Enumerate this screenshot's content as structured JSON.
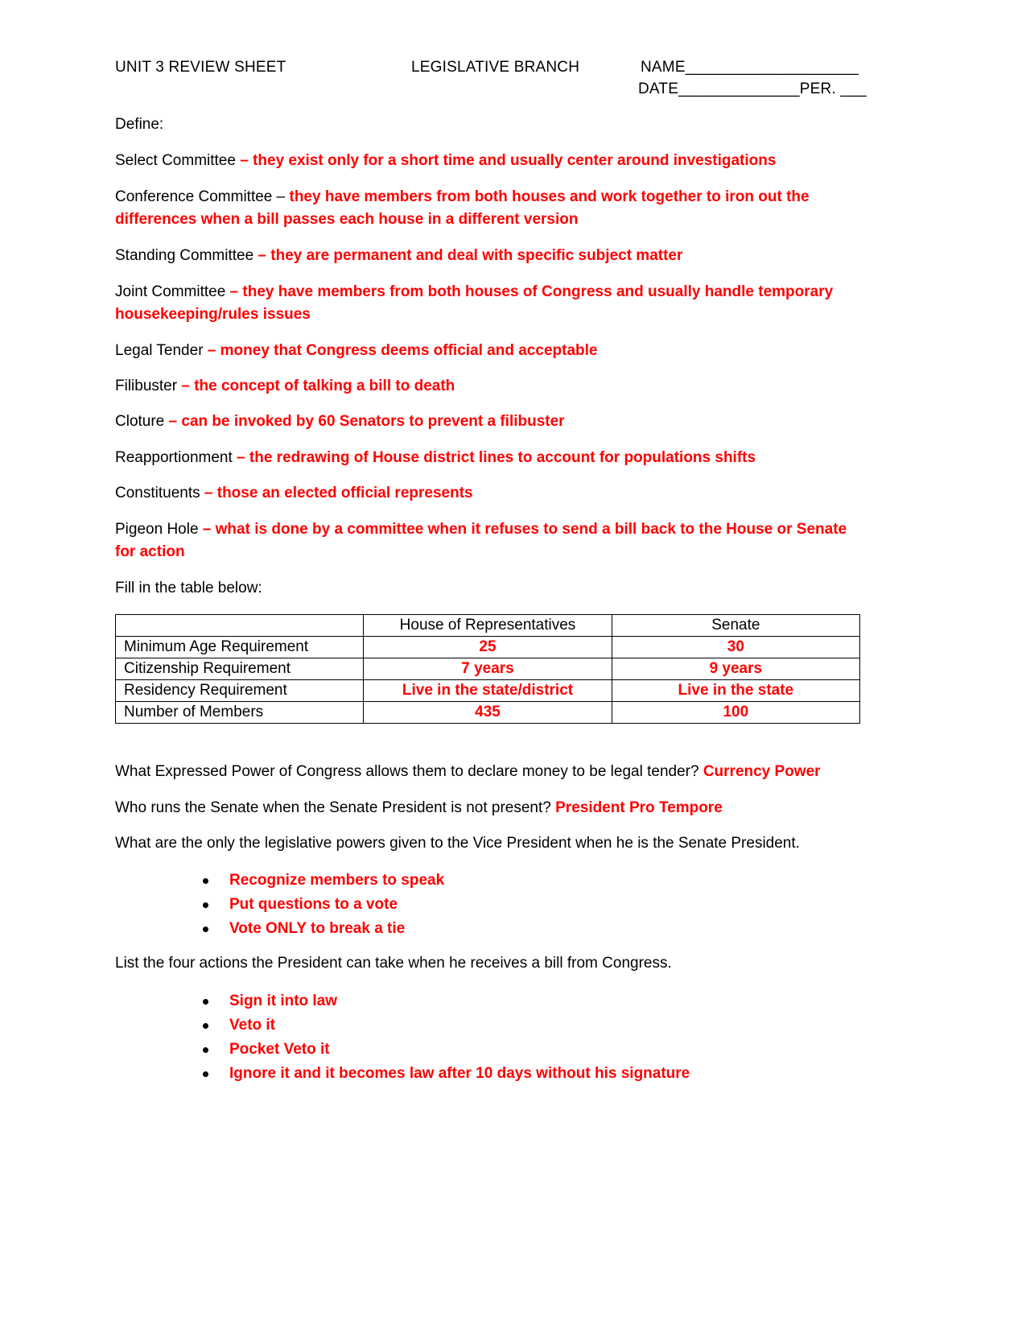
{
  "header": {
    "left": "UNIT 3 REVIEW SHEET",
    "center": "LEGISLATIVE BRANCH",
    "name_field": "NAME____________________",
    "date_field": "DATE______________PER. ___"
  },
  "define_label": "Define:",
  "definitions": [
    {
      "term": "Select Committee",
      "dash": " – ",
      "answer": "they exist only for a short time and usually center around investigations",
      "answer_dash": true
    },
    {
      "term": "Conference Committee",
      "dash": " – ",
      "answer": "they have members from both houses and work together to iron out the differences when a bill passes each house in a different version",
      "answer_dash": false
    },
    {
      "term": "Standing Committee",
      "dash": " – ",
      "answer": "they are permanent and deal with specific subject matter",
      "answer_dash": true
    },
    {
      "term": "Joint Committee",
      "dash": " – ",
      "answer": "they have members from both houses of Congress and usually handle temporary housekeeping/rules issues",
      "answer_dash": true
    },
    {
      "term": "Legal Tender",
      "dash": " – ",
      "answer": "money that Congress deems official and acceptable",
      "answer_dash": true
    },
    {
      "term": "Filibuster",
      "dash": " – ",
      "answer": "the concept of talking a bill to death",
      "answer_dash": true
    },
    {
      "term": "Cloture",
      "dash": " – ",
      "answer": "can be invoked by 60 Senators to prevent a filibuster",
      "answer_dash": true
    },
    {
      "term": "Reapportionment",
      "dash": " – ",
      "answer": "the redrawing of House district lines to account for populations shifts",
      "answer_dash": true
    },
    {
      "term": "Constituents",
      "dash": " – ",
      "answer": "those an elected official represents",
      "answer_dash": true
    },
    {
      "term": "Pigeon Hole",
      "dash": " – ",
      "answer": "what is done by a committee when it refuses to send a bill back to the House or Senate for action",
      "answer_dash": true
    }
  ],
  "table_intro": "Fill in the table below:",
  "table": {
    "columns": [
      "",
      "House of Representatives",
      "Senate"
    ],
    "rows": [
      {
        "label": "Minimum Age Requirement",
        "house": "25",
        "senate": "30"
      },
      {
        "label": "Citizenship Requirement",
        "house": "7 years",
        "senate": "9 years"
      },
      {
        "label": "Residency Requirement",
        "house": "Live in the state/district",
        "senate": "Live in the state"
      },
      {
        "label": "Number of Members",
        "house": "435",
        "senate": "100"
      }
    ]
  },
  "questions": [
    {
      "question": "What Expressed Power of Congress allows them to declare money to be legal tender?",
      "answer": "Currency Power"
    },
    {
      "question": "Who runs the Senate when the Senate President is not present?",
      "answer": "President Pro Tempore"
    },
    {
      "question": "What are the only the legislative powers given to the Vice President when he is the Senate President.",
      "answer": ""
    }
  ],
  "vp_powers": [
    "Recognize members to speak",
    "Put questions to a vote",
    "Vote ONLY to break a tie"
  ],
  "president_question": "List the four actions the President can take when he receives a bill from Congress.",
  "president_actions": [
    "Sign it into law",
    "Veto it",
    "Pocket Veto it",
    "Ignore it and it becomes law after 10 days without his signature"
  ],
  "colors": {
    "answer": "#ff0000",
    "text": "#000000",
    "background": "#ffffff"
  }
}
